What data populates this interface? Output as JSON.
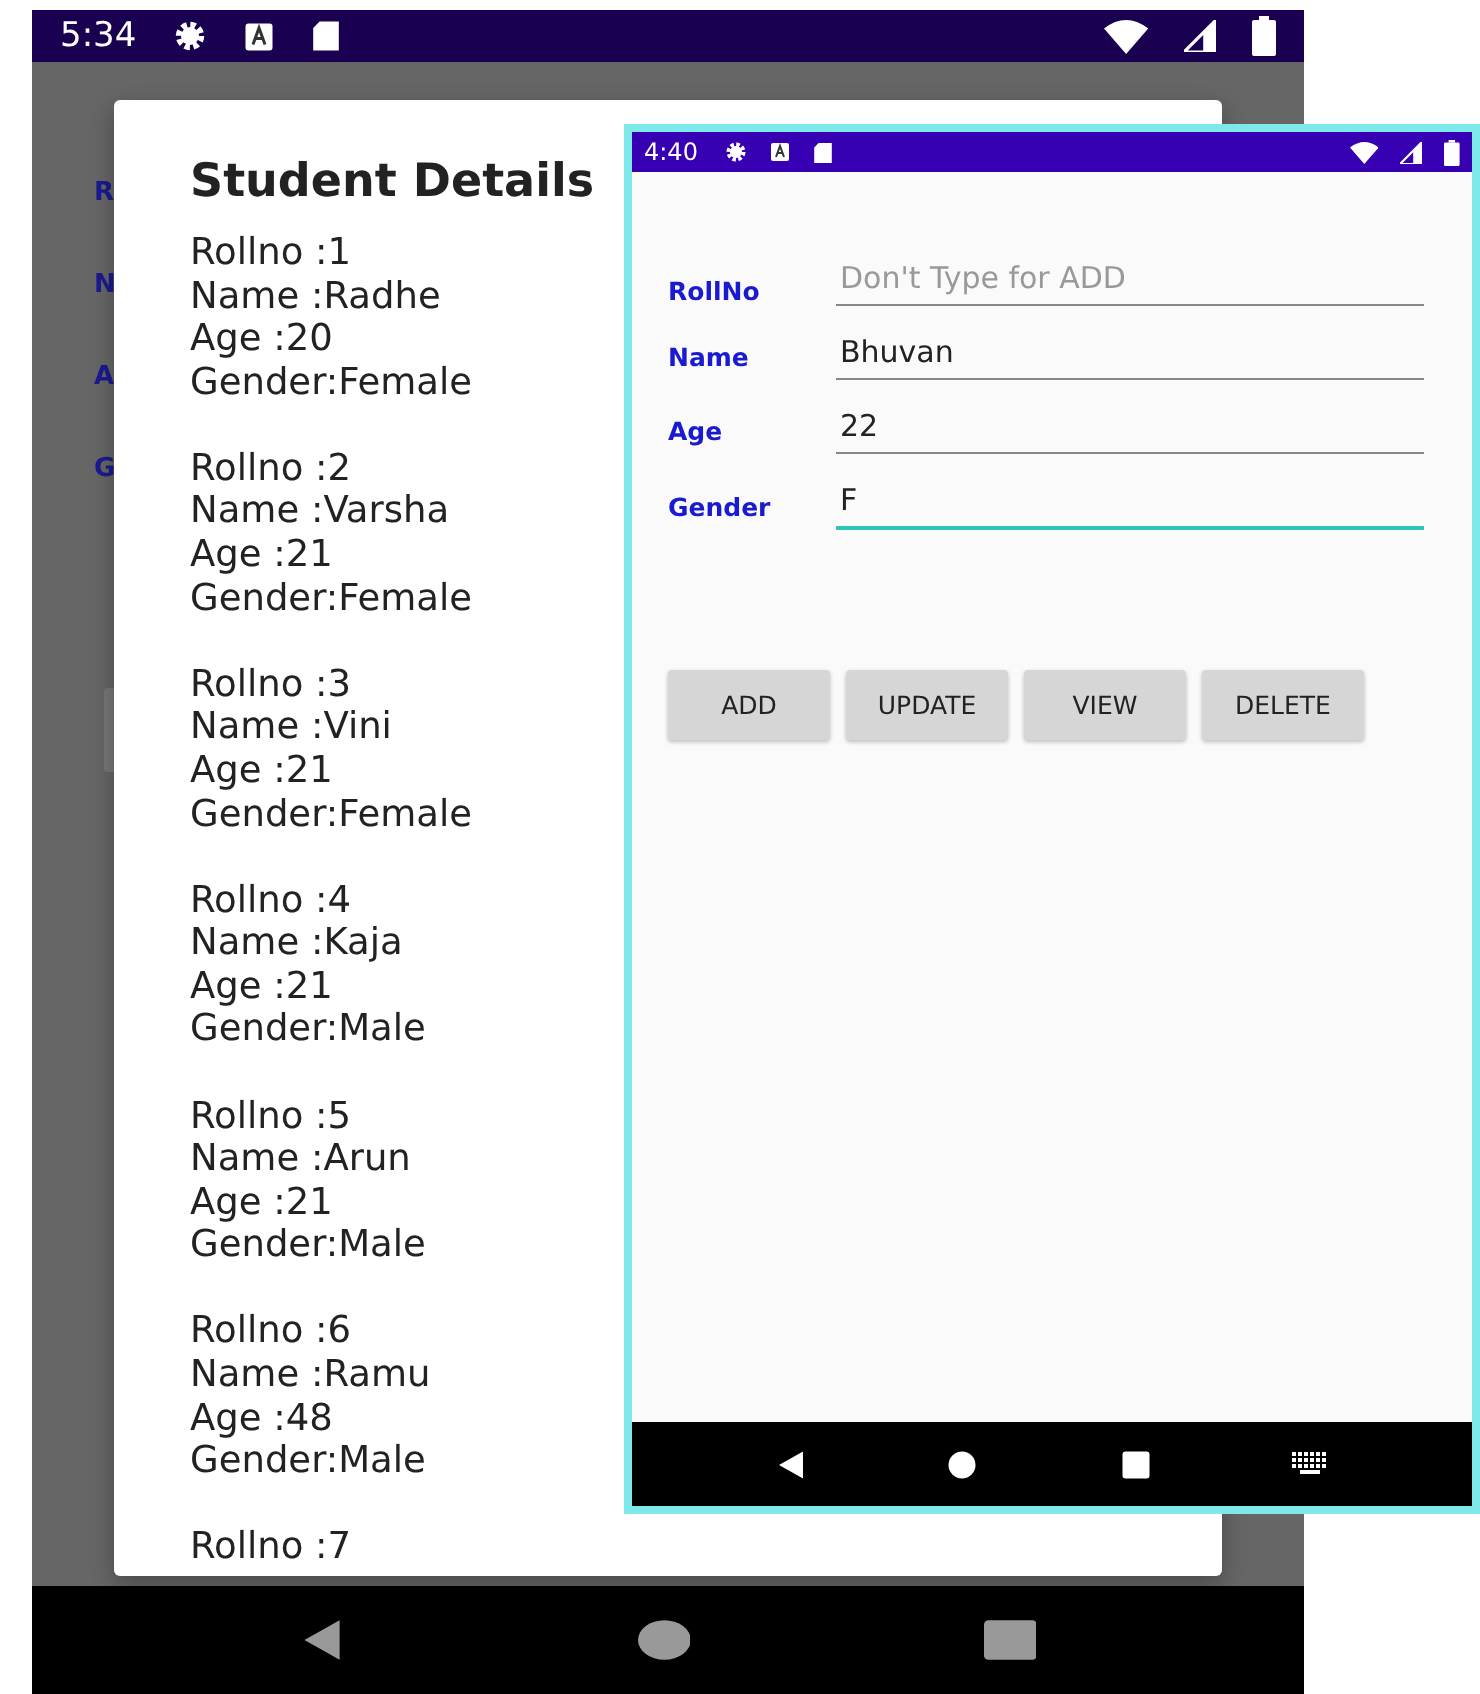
{
  "back_phone": {
    "status_bar": {
      "time": "5:34"
    },
    "behind_labels": [
      "R",
      "N",
      "A",
      "G"
    ],
    "dialog": {
      "title": "Student Details",
      "students": [
        {
          "rollno": "Rollno :1",
          "name": "Name :Radhe",
          "age": "Age :20",
          "gender": "Gender:Female"
        },
        {
          "rollno": "Rollno :2",
          "name": "Name :Varsha",
          "age": "Age :21",
          "gender": "Gender:Female"
        },
        {
          "rollno": "Rollno :3",
          "name": "Name :Vini",
          "age": "Age :21",
          "gender": "Gender:Female"
        },
        {
          "rollno": "Rollno :4",
          "name": "Name :Kaja",
          "age": "Age :21",
          "gender": "Gender:Male"
        },
        {
          "rollno": "Rollno :5",
          "name": "Name :Arun",
          "age": "Age :21",
          "gender": "Gender:Male"
        },
        {
          "rollno": "Rollno :6",
          "name": "Name :Ramu",
          "age": "Age :48",
          "gender": "Gender:Male"
        }
      ],
      "cut_line": "Rollno :7"
    }
  },
  "front_phone": {
    "status_bar": {
      "time": "4:40"
    },
    "fields": [
      {
        "label": "RollNo",
        "placeholder": "Don't Type for ADD",
        "focused": false
      },
      {
        "label": "Name",
        "value": "Bhuvan",
        "focused": false
      },
      {
        "label": "Age",
        "value": "22",
        "focused": false
      },
      {
        "label": "Gender",
        "value": "F",
        "focused": true
      }
    ],
    "buttons": [
      "ADD",
      "UPDATE",
      "VIEW",
      "DELETE"
    ]
  }
}
